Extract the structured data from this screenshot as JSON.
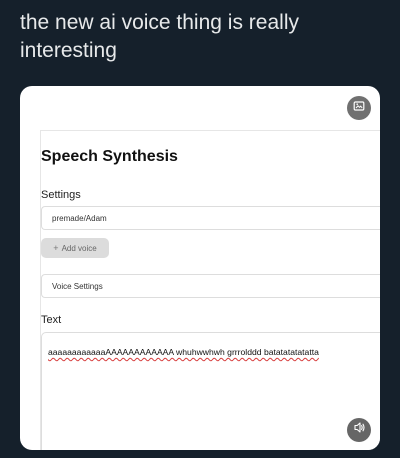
{
  "tweet": {
    "text": "the new ai voice thing is really interesting"
  },
  "media": {
    "alt_icon": "alt-text-badge-icon",
    "volume_icon": "volume-icon"
  },
  "app": {
    "title": "Speech Synthesis",
    "settings_label": "Settings",
    "voice_select_value": "premade/Adam",
    "add_voice_label": "Add voice",
    "voice_settings_label": "Voice Settings",
    "text_label": "Text",
    "text_value": "aaaaaaaaaaaaAAAAAAAAAAAA whuhwwhwh grrrolddd batatatatatatta"
  },
  "colors": {
    "background": "#15202b",
    "tweet_text": "#e7e9ea",
    "card": "#ffffff",
    "spellcheck_underline": "#d63a3a"
  }
}
